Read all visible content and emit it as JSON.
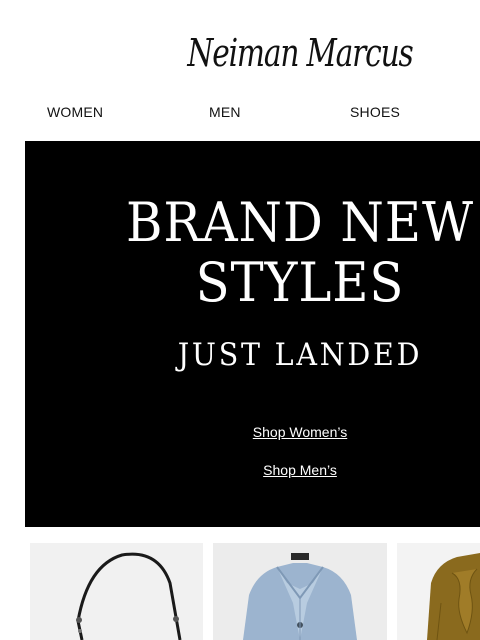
{
  "brand": {
    "logo_text": "Neiman Marcus"
  },
  "nav": {
    "items": [
      "WOMEN",
      "MEN",
      "SHOES"
    ]
  },
  "hero": {
    "headline_line1": "BRAND NEW",
    "headline_line2": "STYLES",
    "subheadline": "JUST LANDED",
    "cta_women": "Shop Women’s",
    "cta_men": "Shop Men’s"
  },
  "products": [
    {
      "image": "black leather shoulder bag"
    },
    {
      "image": "light blue button jacket"
    },
    {
      "image": "olive bow blouse"
    }
  ]
}
